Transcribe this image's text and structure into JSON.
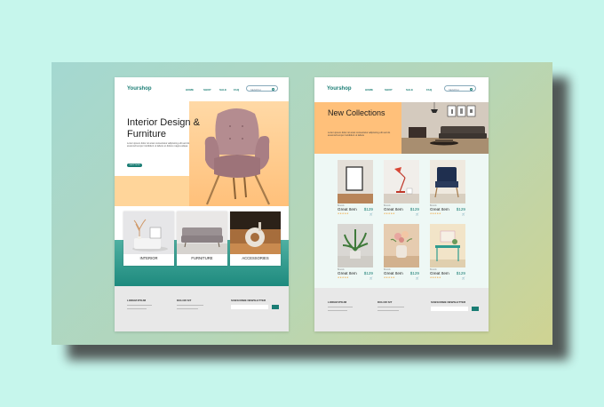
{
  "colors": {
    "background": "#c6f6ec",
    "accent": "#1a7d74",
    "peach": "#ffc07a"
  },
  "left_page": {
    "nav": {
      "logo": "Yourshop",
      "links": [
        "HOME",
        "SHOP",
        "SALE",
        "FAQ"
      ],
      "search_placeholder": "SEARCH"
    },
    "hero": {
      "title": "Interior Design & Furniture",
      "text": "Lorem ipsum dolor sit amet consectetur adipiscing elit sed do eiusmod tempor incididunt ut labore et dolore magna aliqua",
      "button": "SHOP NOW"
    },
    "categories": [
      "INTERIOR",
      "FURNITURE",
      "ACCESSORIES"
    ],
    "footer": {
      "col1": "LOREM IPSUM",
      "col2": "DOLOR SIT",
      "col3": "SUBSCRIBE NEWSLETTER"
    }
  },
  "right_page": {
    "nav": {
      "logo": "Yourshop",
      "links": [
        "HOME",
        "SHOP",
        "SALE",
        "FAQ"
      ],
      "search_placeholder": "SEARCH"
    },
    "hero": {
      "title": "New Collections",
      "text": "Lorem ipsum dolor sit amet consectetur adipiscing elit sed do eiusmod tempor incididunt ut labore"
    },
    "products": [
      {
        "brand": "Brands",
        "name": "Great Item",
        "price": "$129",
        "stars": "★★★★★",
        "icon": "frame"
      },
      {
        "brand": "Brands",
        "name": "Great Item",
        "price": "$129",
        "stars": "★★★★★",
        "icon": "lamp"
      },
      {
        "brand": "Brands",
        "name": "Great Item",
        "price": "$129",
        "stars": "★★★★★",
        "icon": "chair"
      },
      {
        "brand": "Brands",
        "name": "Great Item",
        "price": "$129",
        "stars": "★★★★★",
        "icon": "plant"
      },
      {
        "brand": "Brands",
        "name": "Great Item",
        "price": "$129",
        "stars": "★★★★★",
        "icon": "flowers"
      },
      {
        "brand": "Brands",
        "name": "Great Item",
        "price": "$129",
        "stars": "★★★★★",
        "icon": "desk"
      }
    ],
    "cart_glyph": "🛒",
    "footer": {
      "col1": "LOREM IPSUM",
      "col2": "DOLOR SIT",
      "col3": "SUBSCRIBE NEWSLETTER"
    }
  }
}
